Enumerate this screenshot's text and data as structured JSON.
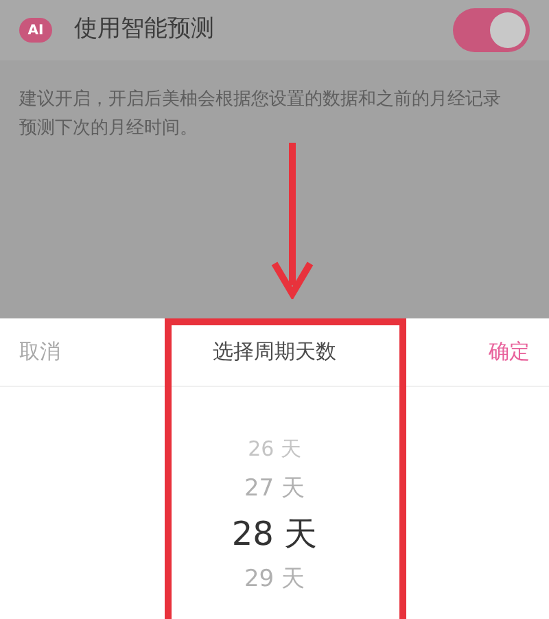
{
  "setting": {
    "icon_text": "AI",
    "title": "使用智能预测",
    "on": true,
    "description": "建议开启，开启后美柚会根据您设置的数据和之前的月经记录预测下次的月经时间。"
  },
  "sheet": {
    "cancel": "取消",
    "title": "选择周期天数",
    "confirm": "确定"
  },
  "picker": [
    {
      "label": "26 天",
      "selected": false
    },
    {
      "label": "27 天",
      "selected": false
    },
    {
      "label": "28 天",
      "selected": true
    },
    {
      "label": "29 天",
      "selected": false
    }
  ]
}
